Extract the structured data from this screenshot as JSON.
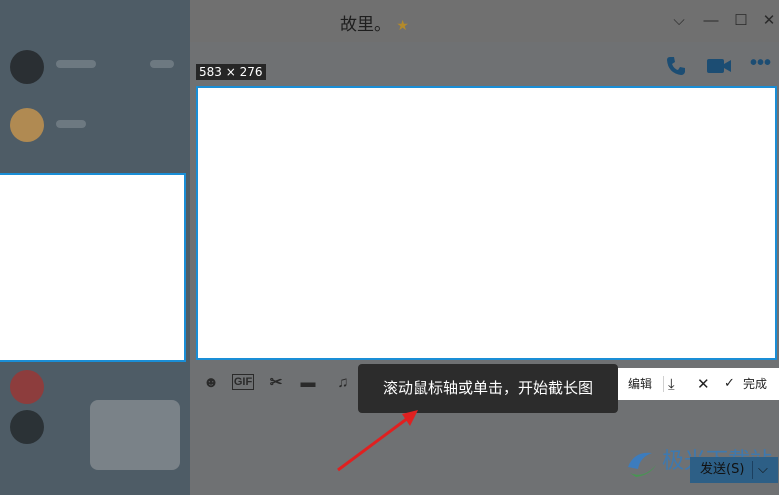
{
  "window": {
    "title": "故里。",
    "minimize": "—",
    "maximize": "☐",
    "close": "✕",
    "dropdown": "⌵"
  },
  "capture": {
    "size_label": "583 × 276"
  },
  "tooltip": {
    "text": "滚动鼠标轴或单击，开始截长图"
  },
  "action_bar": {
    "edit": "编辑",
    "done": "完成"
  },
  "composer": {
    "send_label": "发送(S)"
  },
  "watermark": {
    "text": "极光下载站"
  },
  "colors": {
    "accent": "#1a8ed6",
    "tooltip_bg": "#2c2c2c",
    "arrow": "#e02020"
  }
}
